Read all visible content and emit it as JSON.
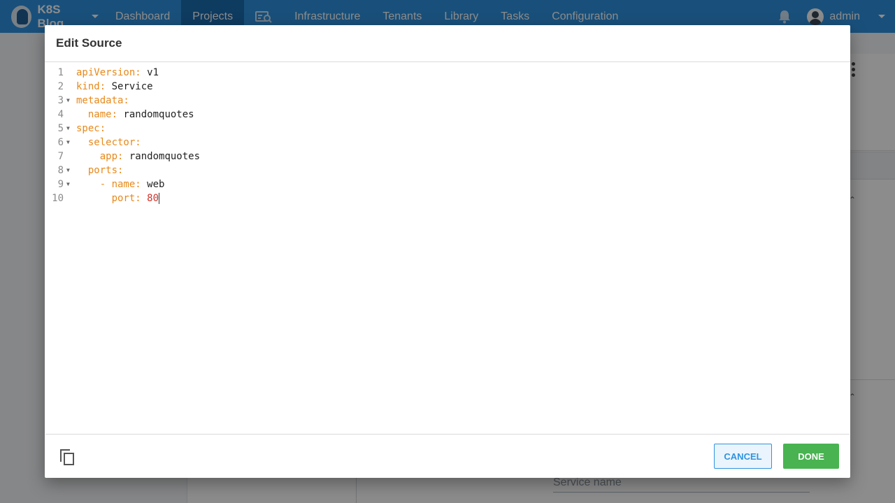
{
  "topnav": {
    "brand": "K8S Blog",
    "items": [
      {
        "label": "Dashboard"
      },
      {
        "label": "Projects",
        "active": true
      },
      {
        "label": "Infrastructure"
      },
      {
        "label": "Tenants"
      },
      {
        "label": "Library"
      },
      {
        "label": "Tasks"
      },
      {
        "label": "Configuration"
      }
    ],
    "user": "admin"
  },
  "background": {
    "field_placeholder": "Service name"
  },
  "dialog": {
    "title": "Edit Source",
    "lines": [
      {
        "num": "1",
        "indent": "",
        "key": "apiVersion:",
        "value": "v1",
        "fold": false
      },
      {
        "num": "2",
        "indent": "",
        "key": "kind:",
        "value": "Service",
        "fold": false
      },
      {
        "num": "3",
        "indent": "",
        "key": "metadata:",
        "value": "",
        "fold": true
      },
      {
        "num": "4",
        "indent": "  ",
        "key": "name:",
        "value": "randomquotes",
        "fold": false
      },
      {
        "num": "5",
        "indent": "",
        "key": "spec:",
        "value": "",
        "fold": true
      },
      {
        "num": "6",
        "indent": "  ",
        "key": "selector:",
        "value": "",
        "fold": true
      },
      {
        "num": "7",
        "indent": "    ",
        "key": "app:",
        "value": "randomquotes",
        "fold": false
      },
      {
        "num": "8",
        "indent": "  ",
        "key": "ports:",
        "value": "",
        "fold": true
      },
      {
        "num": "9",
        "indent": "    ",
        "key": "- name:",
        "value": "web",
        "fold": true
      },
      {
        "num": "10",
        "indent": "      ",
        "key": "port:",
        "value": "80",
        "numeric": true,
        "fold": false
      }
    ],
    "cancel_label": "CANCEL",
    "done_label": "DONE"
  },
  "colors": {
    "nav": "#2f93e0",
    "nav_active": "#1a6cb0",
    "yaml_key": "#e8891a",
    "yaml_number": "#d0342c",
    "done": "#48b350"
  }
}
